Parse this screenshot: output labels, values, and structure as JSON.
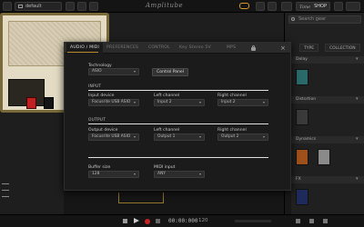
{
  "topbar": {
    "preset_name": "default",
    "brand": "Amplitube",
    "shop_logo": "Tone",
    "shop_label": "SHOP"
  },
  "right_panel": {
    "search_placeholder": "Search gear",
    "tabs": [
      "TYPE",
      "COLLECTION"
    ],
    "sections": [
      "Delay",
      "Distortion",
      "Dynamics",
      "FX"
    ]
  },
  "transport": {
    "time": "00:00:000",
    "bpm": "120"
  },
  "dialog": {
    "tabs": [
      "AUDIO / MIDI",
      "PREFERENCES",
      "CONTROL",
      "Key Stereo 5V",
      "MPS"
    ],
    "active_tab": "AUDIO / MIDI",
    "technology": {
      "label": "Technology",
      "value": "ASIO",
      "control_panel_label": "Control Panel"
    },
    "input": {
      "section": "INPUT",
      "device_label": "Input device",
      "device_value": "Focusrite USB ASIO",
      "left_label": "Left channel",
      "left_value": "Input 2",
      "right_label": "Right channel",
      "right_value": "Input 2"
    },
    "output": {
      "section": "OUTPUT",
      "device_label": "Output device",
      "device_value": "Focusrite USB ASIO",
      "left_label": "Left channel",
      "left_value": "Output 1",
      "right_label": "Right channel",
      "right_value": "Output 2"
    },
    "buffer": {
      "label": "Buffer size",
      "value": "128"
    },
    "midi": {
      "label": "MIDI input",
      "value": "ANY"
    }
  }
}
